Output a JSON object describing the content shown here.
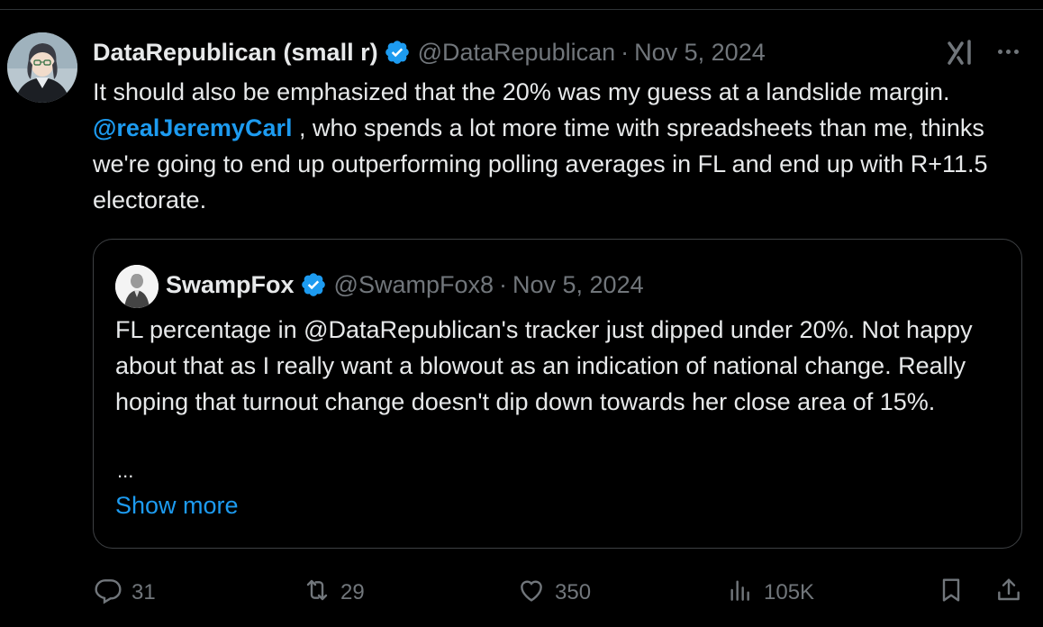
{
  "post": {
    "display_name": "DataRepublican (small r)",
    "handle": "@DataRepublican",
    "separator": "·",
    "date": "Nov 5, 2024",
    "text_part1": "It should also be emphasized that the 20% was my guess at a landslide margin. ",
    "mention": "@realJeremyCarl",
    "text_part2": " , who spends a lot more time with spreadsheets than me, thinks we're going to end up outperforming polling averages in FL and end up with R+11.5 electorate."
  },
  "quote": {
    "display_name": "SwampFox",
    "handle": "@SwampFox8",
    "separator": "·",
    "date": "Nov 5, 2024",
    "text": "FL percentage in @DataRepublican's tracker just dipped under 20%. Not happy about that as I really want a blowout as an indication of national change. Really hoping that turnout change doesn't dip down towards her close area of 15%.",
    "ellipsis": "...",
    "show_more_label": "Show more"
  },
  "actions": {
    "replies": "31",
    "reposts": "29",
    "likes": "350",
    "views": "105K"
  },
  "colors": {
    "background": "#000000",
    "text": "#e7e9ea",
    "muted": "#71767b",
    "accent": "#1d9bf0",
    "border": "#3e4144"
  },
  "icons": {
    "verified": "verified-badge-icon",
    "grok": "grok-icon",
    "more": "more-options-icon",
    "reply": "reply-icon",
    "repost": "repost-icon",
    "like": "heart-icon",
    "views": "views-icon",
    "bookmark": "bookmark-icon",
    "share": "share-icon"
  }
}
